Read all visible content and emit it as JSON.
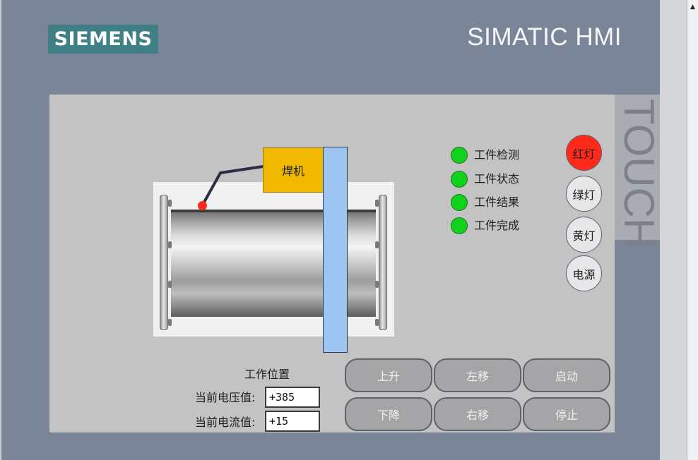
{
  "header": {
    "logo": "SIEMENS",
    "brand": "SIMATIC HMI",
    "touch": "TOUCH"
  },
  "process": {
    "welder_label": "焊机"
  },
  "indicators": [
    {
      "label": "工件检测",
      "color": "#0fd21b"
    },
    {
      "label": "工件状态",
      "color": "#0fd21b"
    },
    {
      "label": "工件结果",
      "color": "#0fd21b"
    },
    {
      "label": "工件完成",
      "color": "#0fd21b"
    }
  ],
  "lamps": [
    {
      "label": "红灯",
      "active": true,
      "color": "#ff2a1a"
    },
    {
      "label": "绿灯",
      "active": false
    },
    {
      "label": "黄灯",
      "active": false
    },
    {
      "label": "电源",
      "active": false
    }
  ],
  "work_position": {
    "title": "工作位置",
    "voltage_label": "当前电压值:",
    "voltage_value": "+385",
    "current_label": "当前电流值:",
    "current_value": "+15"
  },
  "buttons": {
    "up": "上升",
    "left": "左移",
    "start": "启动",
    "down": "下降",
    "right": "右移",
    "stop": "停止"
  }
}
